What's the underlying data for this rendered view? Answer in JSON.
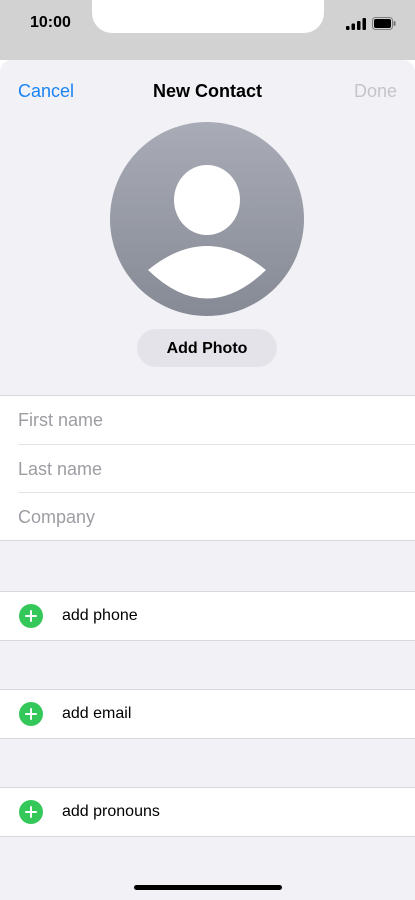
{
  "status_bar": {
    "time": "10:00",
    "signal_icon": "cellular-signal-icon",
    "battery_icon": "battery-icon"
  },
  "nav": {
    "cancel_label": "Cancel",
    "title": "New Contact",
    "done_label": "Done"
  },
  "avatar": {
    "icon": "person-silhouette-icon"
  },
  "add_photo_label": "Add Photo",
  "fields": {
    "first_name_placeholder": "First name",
    "last_name_placeholder": "Last name",
    "company_placeholder": "Company"
  },
  "actions": {
    "add_phone_label": "add phone",
    "add_email_label": "add email",
    "add_pronouns_label": "add pronouns",
    "plus_icon": "add-circle-icon"
  },
  "colors": {
    "accent": "#1a84f5",
    "done_disabled": "#c5c5c9",
    "add_green": "#34c759",
    "sheet_bg": "#f1f1f6"
  }
}
